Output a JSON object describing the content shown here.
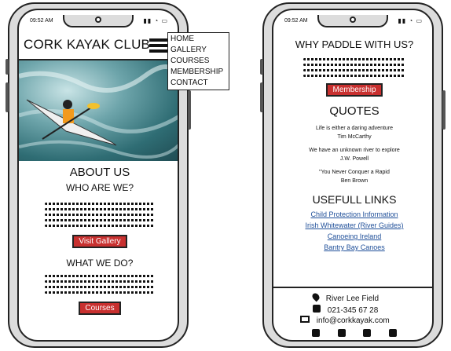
{
  "left": {
    "status_time": "09:52 AM",
    "site_title": "CORK KAYAK CLUB",
    "menu": [
      "HOME",
      "GALLERY",
      "COURSES",
      "MEMBERSHIP",
      "CONTACT"
    ],
    "about_heading": "ABOUT US",
    "who_heading": "WHO ARE WE?",
    "visit_gallery_label": "Visit Gallery",
    "what_heading": "WHAT WE DO?",
    "courses_label": "Courses"
  },
  "right": {
    "status_time": "09:52 AM",
    "why_heading": "WHY PADDLE WITH US?",
    "membership_label": "Membership",
    "quotes_heading": "QUOTES",
    "quotes": [
      {
        "text": "Life is either a daring adventure",
        "author": "Tim McCarthy"
      },
      {
        "text": "We have an unknown river to explore",
        "author": "J.W. Powell"
      },
      {
        "text": "\"You Never Conquer a Rapid",
        "author": "Ben Brown"
      }
    ],
    "links_heading": "USEFULL LINKS",
    "links": [
      "Child Protection Information",
      "Irish Whitewater (River Guides)",
      "Canoeing Ireland",
      "Bantry Bay Canoes"
    ],
    "footer": {
      "address": "River Lee Field",
      "phone": "021-345 67 28",
      "email": "info@corkkayak.com"
    }
  }
}
